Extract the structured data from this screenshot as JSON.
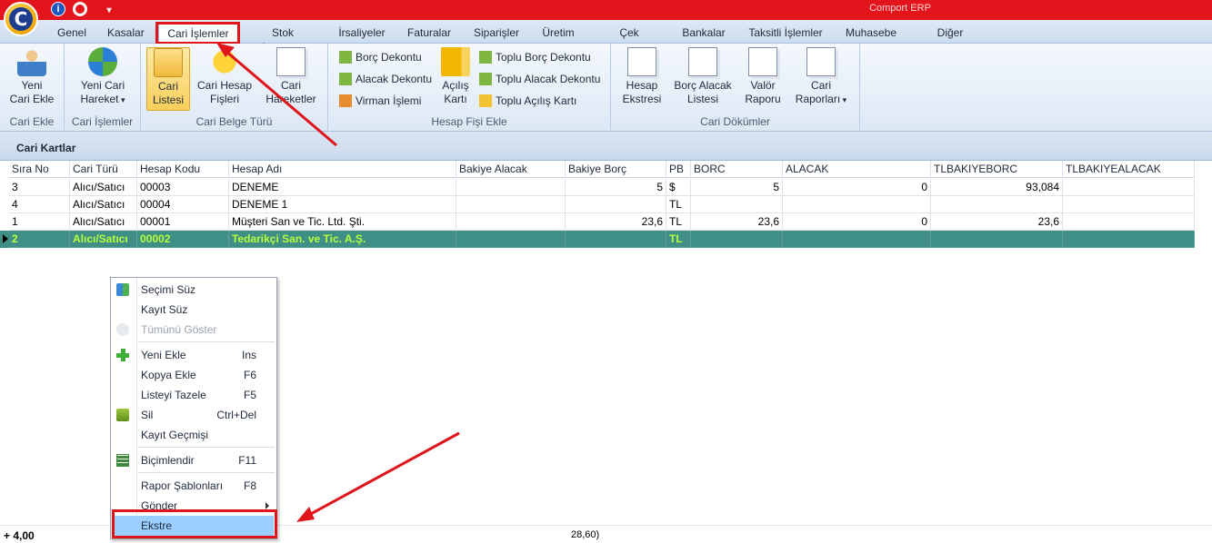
{
  "app": {
    "title": "Comport ERP",
    "logo_letter": "C"
  },
  "quick_access": {
    "info": "i",
    "more": "▾"
  },
  "tabs": [
    {
      "label": "Genel"
    },
    {
      "label": "Kasalar"
    },
    {
      "label": "Cari İşlemler"
    },
    {
      "label": "Stok İşlemleri"
    },
    {
      "label": "İrsaliyeler"
    },
    {
      "label": "Faturalar"
    },
    {
      "label": "Siparişler"
    },
    {
      "label": "Üretim"
    },
    {
      "label": "Çek Senetler"
    },
    {
      "label": "Bankalar"
    },
    {
      "label": "Taksitli İşlemler"
    },
    {
      "label": "Muhasebe"
    },
    {
      "label": "Diğer Kartlar"
    }
  ],
  "ribbon": {
    "groups": {
      "cari_ekle": "Cari Ekle",
      "cari_islemler": "Cari İşlemler",
      "cari_belge_turu": "Cari Belge Türü",
      "hesap_fisi_ekle": "Hesap Fişi Ekle",
      "cari_dokumler": "Cari Dökümler"
    },
    "buttons": {
      "yeni_cari_ekle": [
        "Yeni",
        "Cari Ekle"
      ],
      "yeni_cari_hareket": [
        "Yeni Cari",
        "Hareket"
      ],
      "cari_listesi": [
        "Cari",
        "Listesi"
      ],
      "cari_hesap_fisleri": [
        "Cari Hesap",
        "Fişleri"
      ],
      "cari_hareketler": [
        "Cari",
        "Hareketler"
      ],
      "borc_dekontu": "Borç Dekontu",
      "alacak_dekontu": "Alacak Dekontu",
      "virman_islemi": "Virman İşlemi",
      "acilis_karti": [
        "Açılış",
        "Kartı"
      ],
      "toplu_borc_dekontu": "Toplu Borç Dekontu",
      "toplu_alacak_dekontu": "Toplu Alacak Dekontu",
      "toplu_acilis_karti": "Toplu Açılış Kartı",
      "hesap_ekstresi": [
        "Hesap",
        "Ekstresi"
      ],
      "borc_alacak_listesi": [
        "Borç Alacak",
        "Listesi"
      ],
      "valor_raporu": [
        "Valör",
        "Raporu"
      ],
      "cari_raporlari": [
        "Cari",
        "Raporları"
      ]
    }
  },
  "section": {
    "title": "Cari Kartlar"
  },
  "grid": {
    "columns": [
      "Sıra No",
      "Cari Türü",
      "Hesap Kodu",
      "Hesap Adı",
      "Bakiye Alacak",
      "Bakiye Borç",
      "PB",
      "BORC",
      "ALACAK",
      "TLBAKIYEBORC",
      "TLBAKIYEALACAK"
    ],
    "rows": [
      [
        "3",
        "Alıcı/Satıcı",
        "00003",
        "DENEME",
        "",
        "5",
        "$",
        "5",
        "0",
        "93,084",
        ""
      ],
      [
        "4",
        "Alıcı/Satıcı",
        "00004",
        "DENEME 1",
        "",
        "",
        "TL",
        "",
        "",
        "",
        ""
      ],
      [
        "1",
        "Alıcı/Satıcı",
        "00001",
        "Müşteri San ve Tic. Ltd. Şti.",
        "",
        "23,6",
        "TL",
        "23,6",
        "0",
        "23,6",
        ""
      ],
      [
        "2",
        "Alıcı/Satıcı",
        "00002",
        "Tedarikçi San. ve Tic. A.Ş.",
        "",
        "",
        "TL",
        "",
        "",
        "",
        ""
      ]
    ],
    "selected_row": 3
  },
  "footer": {
    "count": "4,00",
    "total": "28,60)"
  },
  "context_menu": {
    "items": [
      {
        "label": "Seçimi Süz",
        "shortcut": ""
      },
      {
        "label": "Kayıt Süz",
        "shortcut": ""
      },
      {
        "label": "Tümünü Göster",
        "shortcut": ""
      },
      {
        "label": "Yeni Ekle",
        "shortcut": "Ins"
      },
      {
        "label": "Kopya Ekle",
        "shortcut": "F6"
      },
      {
        "label": "Listeyi Tazele",
        "shortcut": "F5"
      },
      {
        "label": "Sil",
        "shortcut": "Ctrl+Del"
      },
      {
        "label": "Kayıt Geçmişi",
        "shortcut": ""
      },
      {
        "label": "Biçimlendir",
        "shortcut": "F11"
      },
      {
        "label": "Rapor Şablonları",
        "shortcut": "F8"
      },
      {
        "label": "Gönder",
        "shortcut": ""
      },
      {
        "label": "Ekstre",
        "shortcut": ""
      }
    ]
  },
  "colors": {
    "titlebar": "#e3141b",
    "selected_row_bg": "#3f8f86",
    "selected_row_text": "#b6ff3c",
    "menu_highlight": "#9bcfff",
    "annotation": "#e0141b"
  }
}
